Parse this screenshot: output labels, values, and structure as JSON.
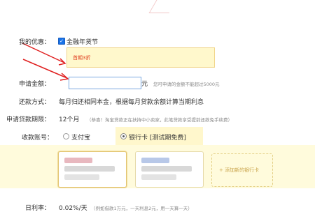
{
  "form": {
    "discount_label": "我的优惠：",
    "discount_checkbox_label": "金融年货节",
    "discount_notice": "首期3折",
    "amount_label": "申请金额：",
    "amount_value": "",
    "amount_unit": "元",
    "amount_hint": "您可申请的金额不能超过5000元",
    "repay_label": "还款方式：",
    "repay_text": "每月归还相同本金，根据每月贷款余额计算当期利息",
    "term_label": "申请贷款期限：",
    "term_value": "12个月",
    "term_note": "（恭喜！淘宝贷款正在扶持中小卖家，此笔贷款享受提前还款免手续费）",
    "account_label": "收款账号：",
    "option_alipay": "支付宝",
    "option_bank": "银行卡 [测试期免费]",
    "add_card": "+ 添加新的银行卡",
    "rate_label": "日利率：",
    "rate_value": "0.02%/天",
    "rate_note": "（例如借款1万元，一天利息2元，用一天算一天）"
  },
  "colors": {
    "accent_red": "#e02020",
    "highlight_yellow": "#fffbdc",
    "checkbox_blue": "#1a73e8"
  }
}
